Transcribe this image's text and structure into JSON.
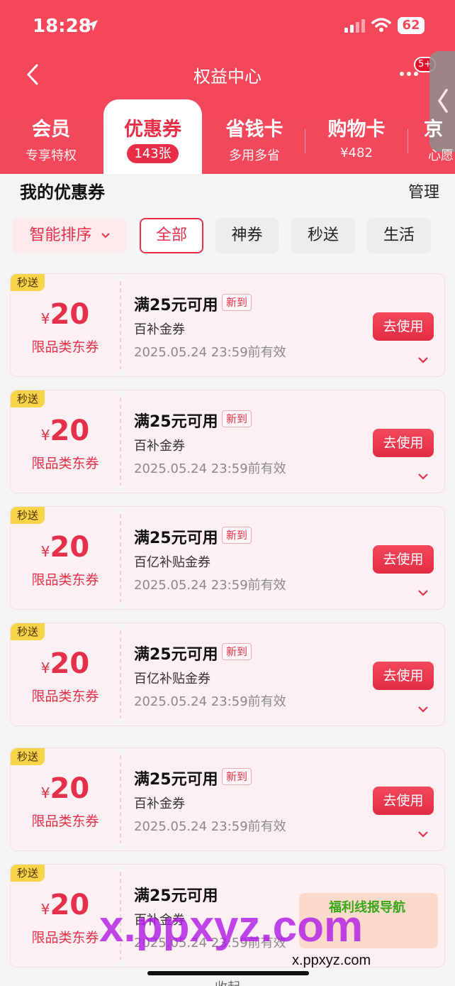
{
  "status_bar": {
    "time": "18:28",
    "battery": "62"
  },
  "nav": {
    "title": "权益中心",
    "badge": "5+"
  },
  "tabs": [
    {
      "label": "会员",
      "sub": "专享特权",
      "active": false
    },
    {
      "label": "优惠券",
      "sub": "143张",
      "active": true
    },
    {
      "label": "省钱卡",
      "sub": "多用多省",
      "active": false
    },
    {
      "label": "购物卡",
      "sub": "¥482",
      "active": false
    },
    {
      "label": "京",
      "sub": "心愿",
      "active": false
    }
  ],
  "section": {
    "title": "我的优惠券",
    "manage": "管理"
  },
  "filters": {
    "sort": "智能排序",
    "all": "全部",
    "shen": "神券",
    "miaosong": "秒送",
    "life": "生活"
  },
  "coupons": [
    {
      "tag": "秒送",
      "currency": "¥",
      "amount": "20",
      "scope": "限品类东券",
      "condition": "满25元可用",
      "new": "新到",
      "type": "百补金券",
      "expire": "2025.05.24 23:59前有效",
      "button": "去使用"
    },
    {
      "tag": "秒送",
      "currency": "¥",
      "amount": "20",
      "scope": "限品类东券",
      "condition": "满25元可用",
      "new": "新到",
      "type": "百补金券",
      "expire": "2025.05.24 23:59前有效",
      "button": "去使用"
    },
    {
      "tag": "秒送",
      "currency": "¥",
      "amount": "20",
      "scope": "限品类东券",
      "condition": "满25元可用",
      "new": "新到",
      "type": "百亿补贴金券",
      "expire": "2025.05.24 23:59前有效",
      "button": "去使用"
    },
    {
      "tag": "秒送",
      "currency": "¥",
      "amount": "20",
      "scope": "限品类东券",
      "condition": "满25元可用",
      "new": "新到",
      "type": "百亿补贴金券",
      "expire": "2025.05.24 23:59前有效",
      "button": "去使用"
    },
    {
      "tag": "秒送",
      "currency": "¥",
      "amount": "20",
      "scope": "限品类东券",
      "condition": "满25元可用",
      "new": "新到",
      "type": "百补金券",
      "expire": "2025.05.24 23:59前有效",
      "button": "去使用"
    },
    {
      "tag": "秒送",
      "currency": "¥",
      "amount": "20",
      "scope": "限品类东券",
      "condition": "满25元可用",
      "new": "",
      "type": "百补金券",
      "expire": "2025.05.24 23:59前有效",
      "button": ""
    }
  ],
  "footer": {
    "collapse": "收起"
  },
  "watermark": {
    "main": "x.ppxyz.com",
    "sub": "x.ppxyz.com",
    "badge": "福利线报导航"
  },
  "colors": {
    "brand": "#f2485b",
    "accent": "#e4304a",
    "tag_yellow": "#f8d548"
  }
}
